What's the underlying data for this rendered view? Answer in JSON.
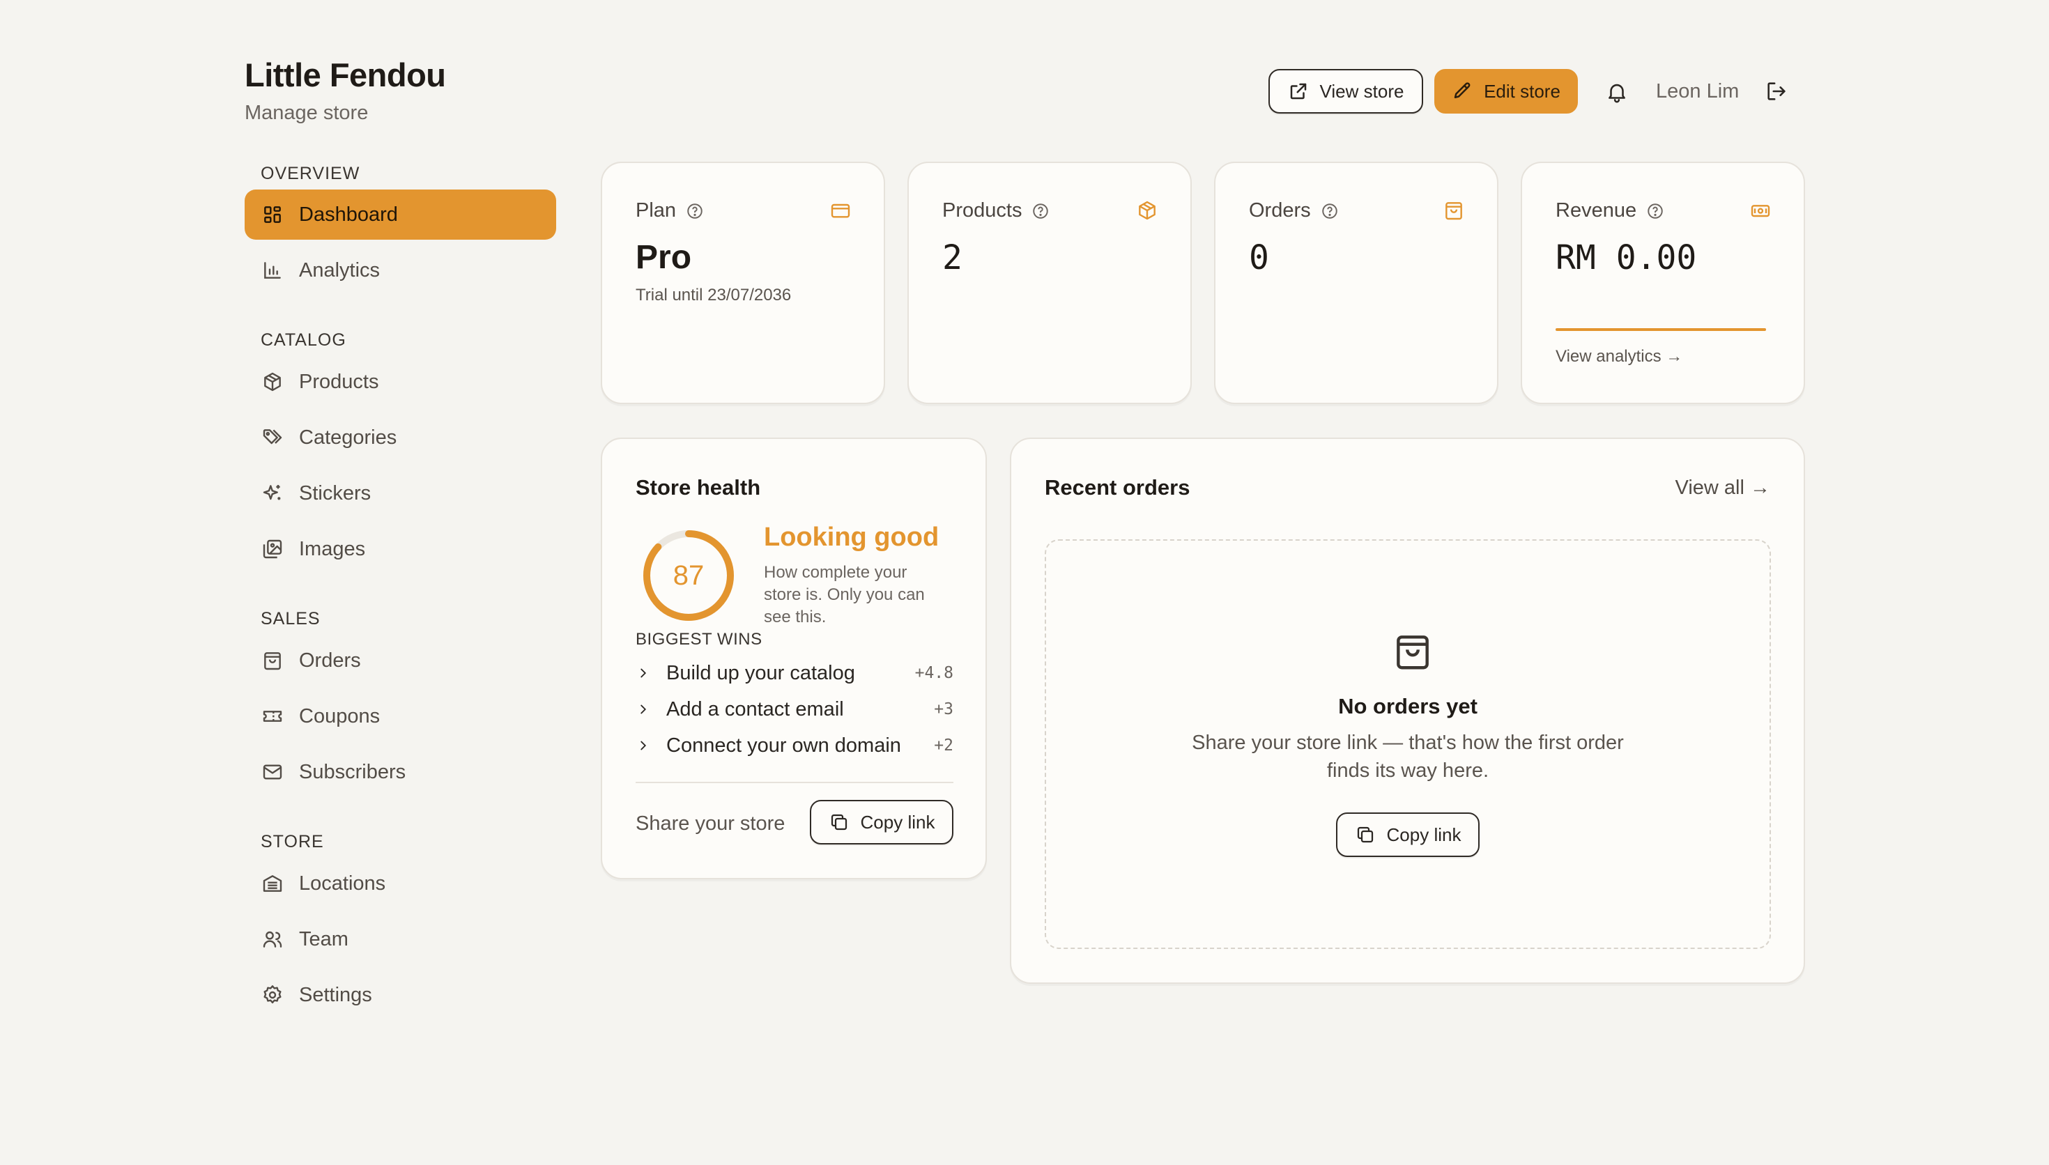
{
  "header": {
    "store_name": "Little Fendou",
    "subtitle": "Manage store",
    "view_store_label": "View store",
    "edit_store_label": "Edit store",
    "user_name": "Leon Lim"
  },
  "sidebar": {
    "sections": {
      "overview": "OVERVIEW",
      "catalog": "CATALOG",
      "sales": "SALES",
      "store": "STORE"
    },
    "items": {
      "dashboard": "Dashboard",
      "analytics": "Analytics",
      "products": "Products",
      "categories": "Categories",
      "stickers": "Stickers",
      "images": "Images",
      "orders": "Orders",
      "coupons": "Coupons",
      "subscribers": "Subscribers",
      "locations": "Locations",
      "team": "Team",
      "settings": "Settings"
    },
    "active_item": "dashboard"
  },
  "stats": {
    "plan": {
      "label": "Plan",
      "value": "Pro",
      "sub": "Trial until 23/07/2036",
      "icon": "credit-card-icon"
    },
    "products": {
      "label": "Products",
      "value": "2",
      "icon": "box-icon"
    },
    "orders": {
      "label": "Orders",
      "value": "0",
      "icon": "shopping-bag-icon"
    },
    "revenue": {
      "label": "Revenue",
      "value": "RM 0.00",
      "link": "View analytics →",
      "icon": "banknote-icon"
    }
  },
  "store_health": {
    "title": "Store health",
    "score": "87",
    "score_percent": 87,
    "headline": "Looking good",
    "description": "How complete your store is. Only you can see this.",
    "wins_label": "BIGGEST WINS",
    "wins": [
      {
        "label": "Build up your catalog",
        "points": "+4.8"
      },
      {
        "label": "Add a contact email",
        "points": "+3"
      },
      {
        "label": "Connect your own domain",
        "points": "+2"
      }
    ],
    "share_label": "Share your store",
    "copy_link_label": "Copy link"
  },
  "recent_orders": {
    "title": "Recent orders",
    "view_all_label": "View all →",
    "empty_title": "No orders yet",
    "empty_desc": "Share your store link — that's how the first order finds its way here.",
    "copy_link_label": "Copy link"
  },
  "colors": {
    "accent": "#e3952f",
    "background": "#f5f4f0",
    "card": "#fdfcf9",
    "text": "#2a2622",
    "muted": "#6b6560"
  }
}
